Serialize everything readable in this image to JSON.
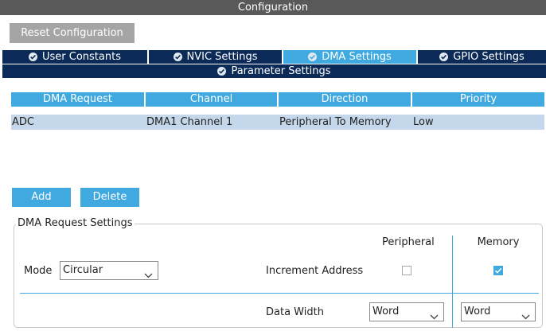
{
  "title": "Configuration",
  "reset_label": "Reset Configuration",
  "tabs": [
    {
      "label": "User Constants",
      "active": false
    },
    {
      "label": "NVIC Settings",
      "active": false
    },
    {
      "label": "DMA Settings",
      "active": true
    },
    {
      "label": "GPIO Settings",
      "active": false
    },
    {
      "label": "Parameter Settings",
      "active": false
    }
  ],
  "table": {
    "headers": [
      "DMA Request",
      "Channel",
      "Direction",
      "Priority"
    ],
    "rows": [
      [
        "ADC",
        "DMA1 Channel 1",
        "Peripheral To Memory",
        "Low"
      ]
    ]
  },
  "buttons": {
    "add": "Add",
    "delete": "Delete"
  },
  "settings": {
    "legend": "DMA Request Settings",
    "mode_label": "Mode",
    "mode_value": "Circular",
    "col_peripheral": "Peripheral",
    "col_memory": "Memory",
    "increment_label": "Increment Address",
    "increment_peripheral": false,
    "increment_memory": true,
    "data_width_label": "Data Width",
    "data_width_peripheral": "Word",
    "data_width_memory": "Word"
  },
  "icons": {
    "tab_status": "check-circle-icon",
    "dropdown": "chevron-down-icon"
  },
  "colors": {
    "accent": "#3fa9e0",
    "tab_dark": "#0b2a57",
    "row_selected": "#c5d7ea",
    "titlebar": "#595959"
  }
}
